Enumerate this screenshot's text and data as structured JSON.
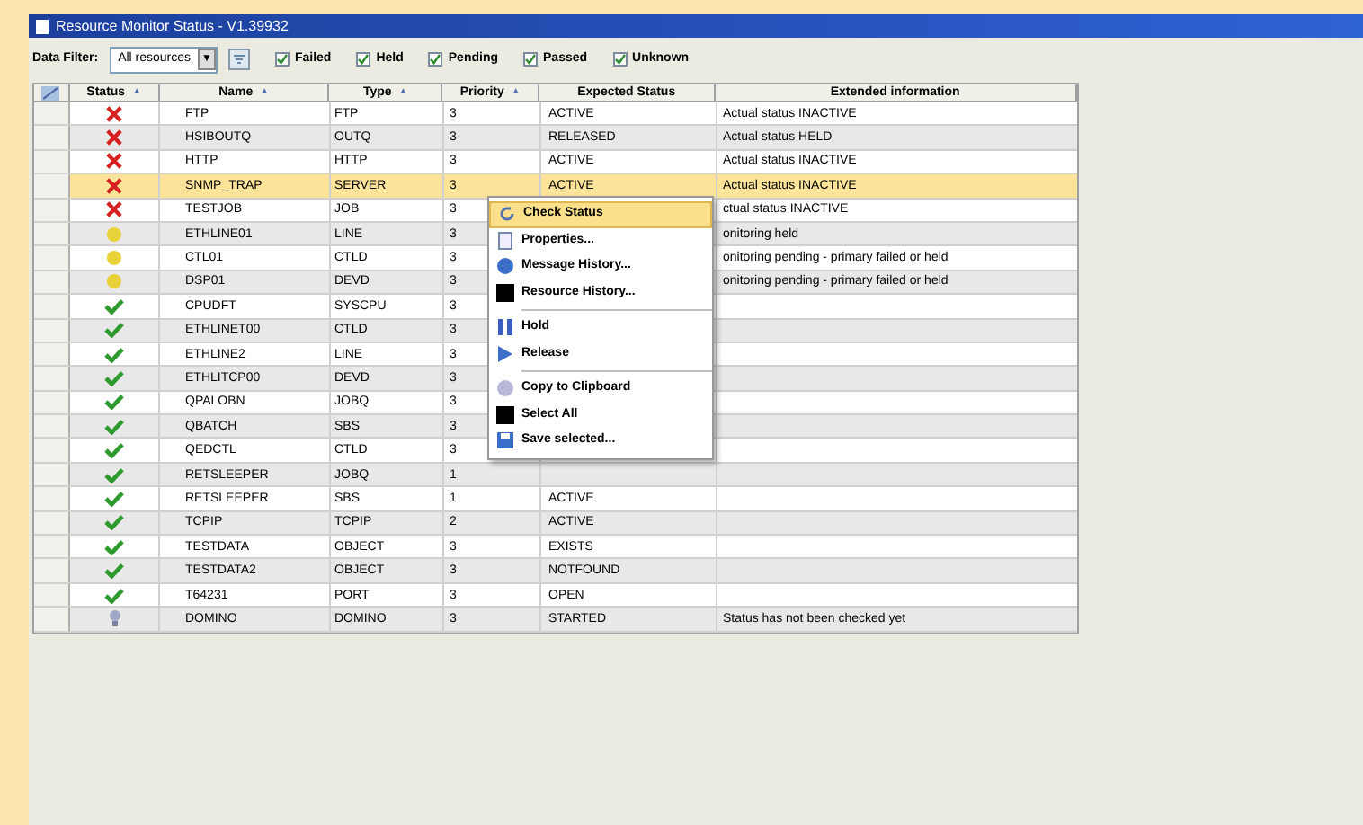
{
  "window": {
    "title": "Resource Monitor Status - V1.39932"
  },
  "toolbar": {
    "filter_label": "Data Filter:",
    "filter_value": "All resources",
    "dropdown_arrow": "▼",
    "filters": [
      {
        "label": "Failed",
        "checked": true
      },
      {
        "label": "Held",
        "checked": true
      },
      {
        "label": "Pending",
        "checked": true
      },
      {
        "label": "Passed",
        "checked": true
      },
      {
        "label": "Unknown",
        "checked": true
      }
    ]
  },
  "table": {
    "columns": [
      {
        "label": "Status",
        "sort": "▲"
      },
      {
        "label": "Name",
        "sort": "▲"
      },
      {
        "label": "Type",
        "sort": "▲"
      },
      {
        "label": "Priority",
        "sort": "▲"
      },
      {
        "label": "Expected Status"
      },
      {
        "label": "Extended information"
      }
    ],
    "rows": [
      {
        "kind": "failed",
        "name": "FTP",
        "type": "FTP",
        "priority": "3",
        "expected": "ACTIVE",
        "info": "Actual status INACTIVE",
        "selected": false
      },
      {
        "kind": "failed",
        "name": "HSIBOUTQ",
        "type": "OUTQ",
        "priority": "3",
        "expected": "RELEASED",
        "info": "Actual status HELD",
        "selected": false
      },
      {
        "kind": "failed",
        "name": "HTTP",
        "type": "HTTP",
        "priority": "3",
        "expected": "ACTIVE",
        "info": "Actual status INACTIVE",
        "selected": false
      },
      {
        "kind": "failed",
        "name": "SNMP_TRAP",
        "type": "SERVER",
        "priority": "3",
        "expected": "ACTIVE",
        "info": "Actual status INACTIVE",
        "selected": true
      },
      {
        "kind": "failed",
        "name": "TESTJOB",
        "type": "JOB",
        "priority": "3",
        "info": "ctual status INACTIVE",
        "selected": false
      },
      {
        "kind": "pending",
        "name": "ETHLINE01",
        "type": "LINE",
        "priority": "3",
        "info": "onitoring held",
        "selected": false
      },
      {
        "kind": "pending",
        "name": "CTL01",
        "type": "CTLD",
        "priority": "3",
        "info": "onitoring pending - primary failed or held",
        "selected": false
      },
      {
        "kind": "pending",
        "name": "DSP01",
        "type": "DEVD",
        "priority": "3",
        "info": "onitoring pending - primary failed or held",
        "selected": false
      },
      {
        "kind": "passed",
        "name": "CPUDFT",
        "type": "SYSCPU",
        "priority": "3",
        "selected": false
      },
      {
        "kind": "passed",
        "name": "ETHLINET00",
        "type": "CTLD",
        "priority": "3",
        "selected": false
      },
      {
        "kind": "passed",
        "name": "ETHLINE2",
        "type": "LINE",
        "priority": "3",
        "selected": false
      },
      {
        "kind": "passed",
        "name": "ETHLITCP00",
        "type": "DEVD",
        "priority": "3",
        "selected": false
      },
      {
        "kind": "passed",
        "name": "QPALOBN",
        "type": "JOBQ",
        "priority": "3",
        "selected": false
      },
      {
        "kind": "passed",
        "name": "QBATCH",
        "type": "SBS",
        "priority": "3",
        "selected": false
      },
      {
        "kind": "passed",
        "name": "QEDCTL",
        "type": "CTLD",
        "priority": "3",
        "selected": false
      },
      {
        "kind": "passed",
        "name": "RETSLEEPER",
        "type": "JOBQ",
        "priority": "1",
        "selected": false
      },
      {
        "kind": "passed",
        "name": "RETSLEEPER",
        "type": "SBS",
        "priority": "1",
        "expected": "ACTIVE",
        "selected": false
      },
      {
        "kind": "passed",
        "name": "TCPIP",
        "type": "TCPIP",
        "priority": "2",
        "expected": "ACTIVE",
        "selected": false
      },
      {
        "kind": "passed",
        "name": "TESTDATA",
        "type": "OBJECT",
        "priority": "3",
        "expected": "EXISTS",
        "selected": false
      },
      {
        "kind": "passed",
        "name": "TESTDATA2",
        "type": "OBJECT",
        "priority": "3",
        "expected": "NOTFOUND",
        "selected": false
      },
      {
        "kind": "passed",
        "name": "T64231",
        "type": "PORT",
        "priority": "3",
        "expected": "OPEN",
        "selected": false
      },
      {
        "kind": "unknown",
        "name": "DOMINO",
        "type": "DOMINO",
        "priority": "3",
        "expected": "STARTED",
        "info": "Status has not been checked yet",
        "selected": false
      }
    ]
  },
  "context_menu": [
    {
      "kind": "item",
      "label": "Check Status",
      "selected": true
    },
    {
      "kind": "item",
      "label": "Properties...",
      "selected": false
    },
    {
      "kind": "item",
      "label": "Message History...",
      "selected": false
    },
    {
      "kind": "item",
      "label": "Resource History...",
      "selected": false
    },
    {
      "kind": "separator"
    },
    {
      "kind": "item",
      "label": "Hold",
      "selected": false
    },
    {
      "kind": "item",
      "label": "Release",
      "selected": false
    },
    {
      "kind": "separator"
    },
    {
      "kind": "item",
      "label": "Copy to Clipboard",
      "selected": false
    },
    {
      "kind": "item",
      "label": "Select All",
      "selected": false
    },
    {
      "kind": "item",
      "label": "Save selected...",
      "selected": false
    }
  ]
}
